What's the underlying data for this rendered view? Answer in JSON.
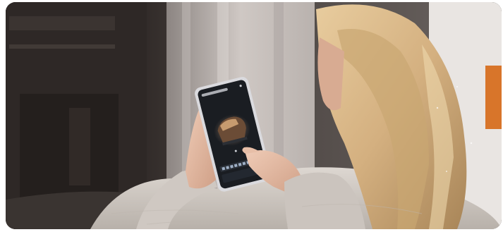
{
  "photo": {
    "subject": "woman-using-smartphone-piano-app",
    "colors": {
      "room_dark": "#2a2523",
      "room_mid": "#4a4340",
      "curtain": "#cfc8c4",
      "window_light": "#e9e5e2",
      "hair": "#d9b98a",
      "hair_shadow": "#b08d60",
      "skin": "#e6bfa8",
      "sweater": "#d8d2cc",
      "phone_body": "#d9d9de",
      "screen": "#1a1d22",
      "accent_orange": "#d8752a"
    }
  }
}
